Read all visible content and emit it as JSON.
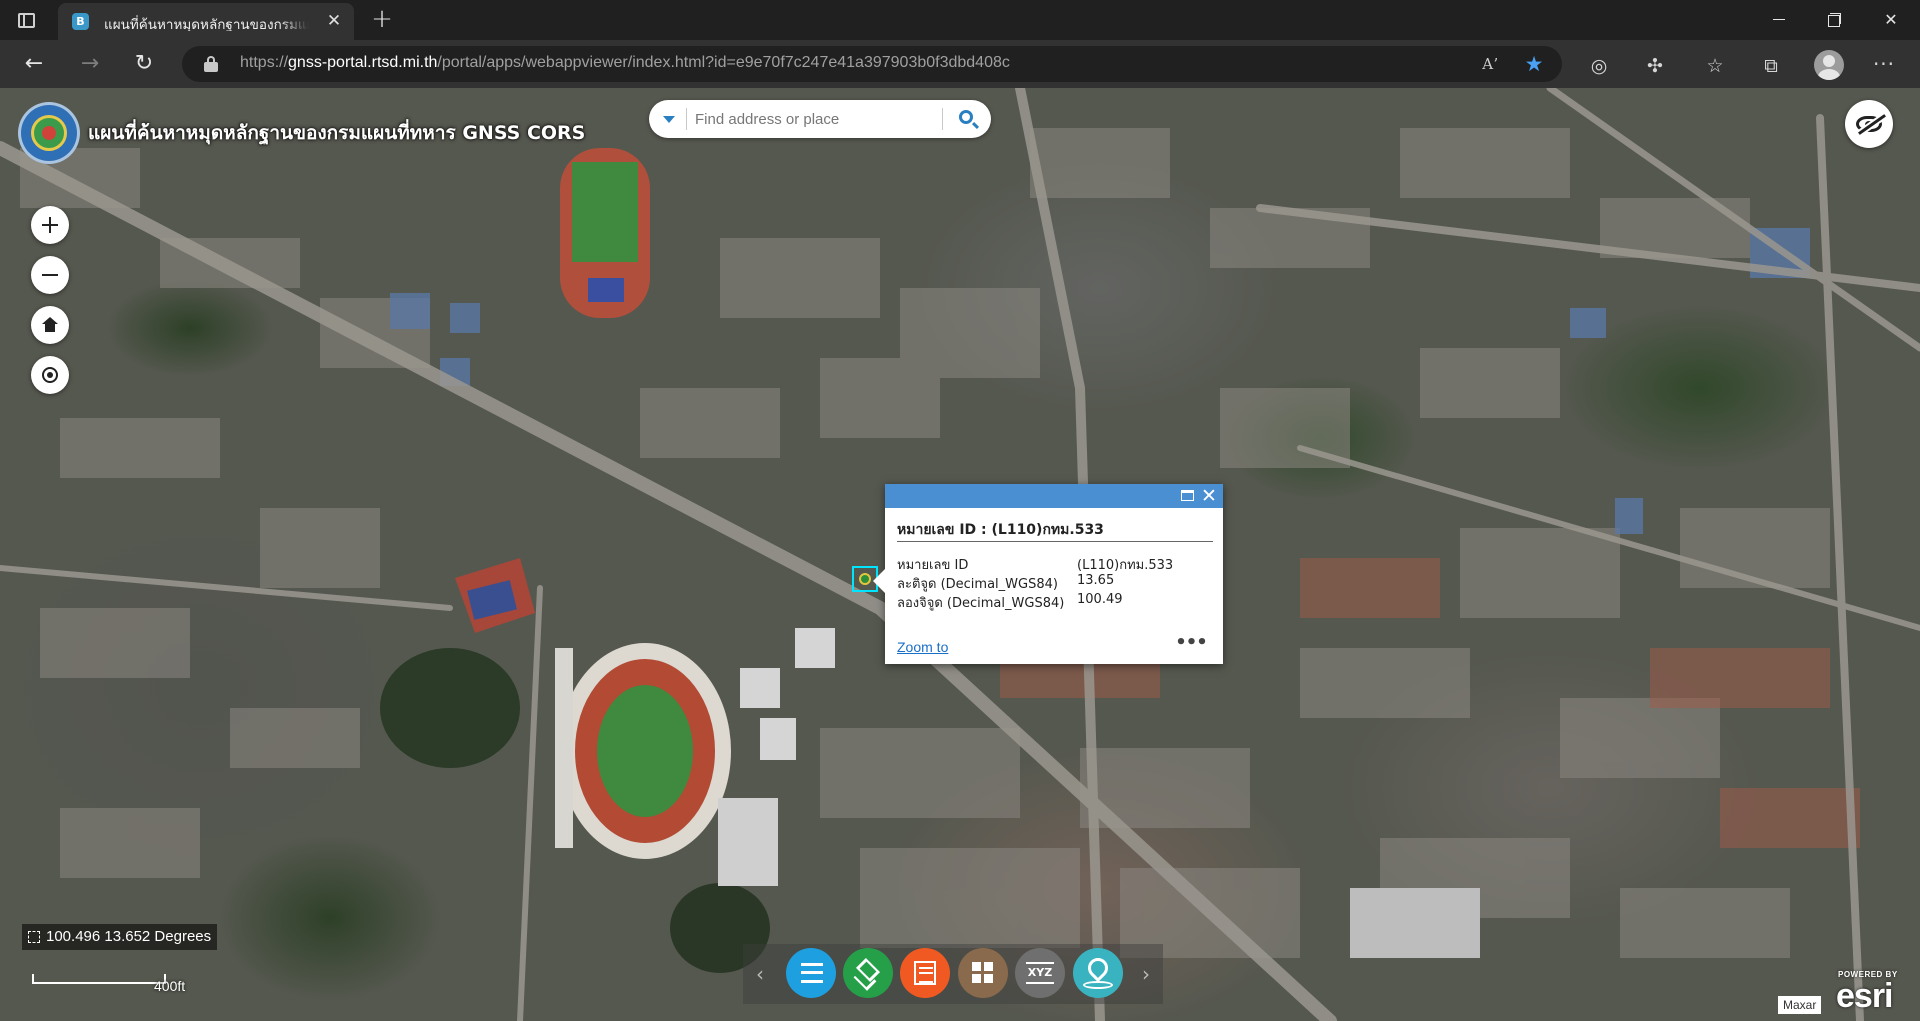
{
  "browser": {
    "tab_title": "แผนที่ค้นหาหมุดหลักฐานของกรมแผนที่ทหาร GNSS CORS",
    "tab_favicon": "B",
    "close_tab": "✕",
    "new_tab": "+",
    "url_scheme": "https://",
    "url_host": "gnss-portal.rtsd.mi.th",
    "url_path": "/portal/apps/webappviewer/index.html?id=e9e70f7c247e41a397903b0f3dbd408c",
    "read_aloud_icon": "Aʼ",
    "favorite_icon": "★",
    "toolbar_icons": [
      "tracking-prevention-icon",
      "extensions-icon",
      "favorites-icon",
      "collections-icon"
    ],
    "more_menu": "···"
  },
  "app": {
    "title": "แผนที่ค้นหาหมุดหลักฐานของกรมแผนที่ทหาร GNSS CORS",
    "search_placeholder": "Find address or place"
  },
  "popup": {
    "title": "หมายเลข ID : (L110)กทม.533",
    "close_label": "✕",
    "attributes": [
      {
        "key": "หมายเลข ID",
        "value": "(L110)กทม.533"
      },
      {
        "key": "ละติจูด (Decimal_WGS84)",
        "value": "13.65"
      },
      {
        "key": "ลองจิจูด (Decimal_WGS84)",
        "value": "100.49"
      }
    ],
    "zoom_to": "Zoom to",
    "more": "•••"
  },
  "map": {
    "coordinates": "100.496 13.652 Degrees",
    "scale_label": "400ft",
    "attribution": "Maxar",
    "esri_powered": "POWERED BY",
    "esri_word": "esri",
    "toolbar_prev": "‹",
    "toolbar_next": "›",
    "xyz_label": "XYZ",
    "highlight_color": "#00e5ff",
    "popup_header_color": "#4b8fd3"
  }
}
